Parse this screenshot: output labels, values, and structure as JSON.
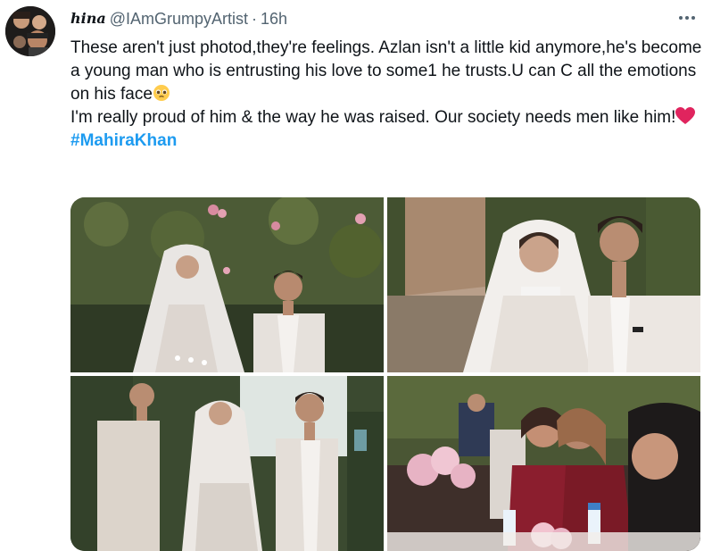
{
  "tweet": {
    "display_name": "hina",
    "handle": "@IAmGrumpyArtist",
    "separator": "·",
    "time": "16h",
    "text_part1": "These aren't just photod,they're feelings. Azlan isn't a little kid anymore,he's become a young man who is entrusting his love to some1 he trusts.U can C all the emotions on his face",
    "text_part2": "I'm really proud of him & the way he was raised. Our society needs men like him!",
    "hashtag": "#MahiraKhan",
    "emojis": [
      "pleading-face-icon",
      "red-heart-icon"
    ],
    "media": [
      {
        "name": "photo-bride-and-groom-garden"
      },
      {
        "name": "photo-bride-and-young-man-closeup"
      },
      {
        "name": "photo-bride-walking-escorted"
      },
      {
        "name": "photo-emotional-guests"
      }
    ]
  },
  "colors": {
    "text": "#0f1419",
    "secondary": "#536471",
    "link": "#1d9bf0",
    "heart": "#e0245e"
  }
}
